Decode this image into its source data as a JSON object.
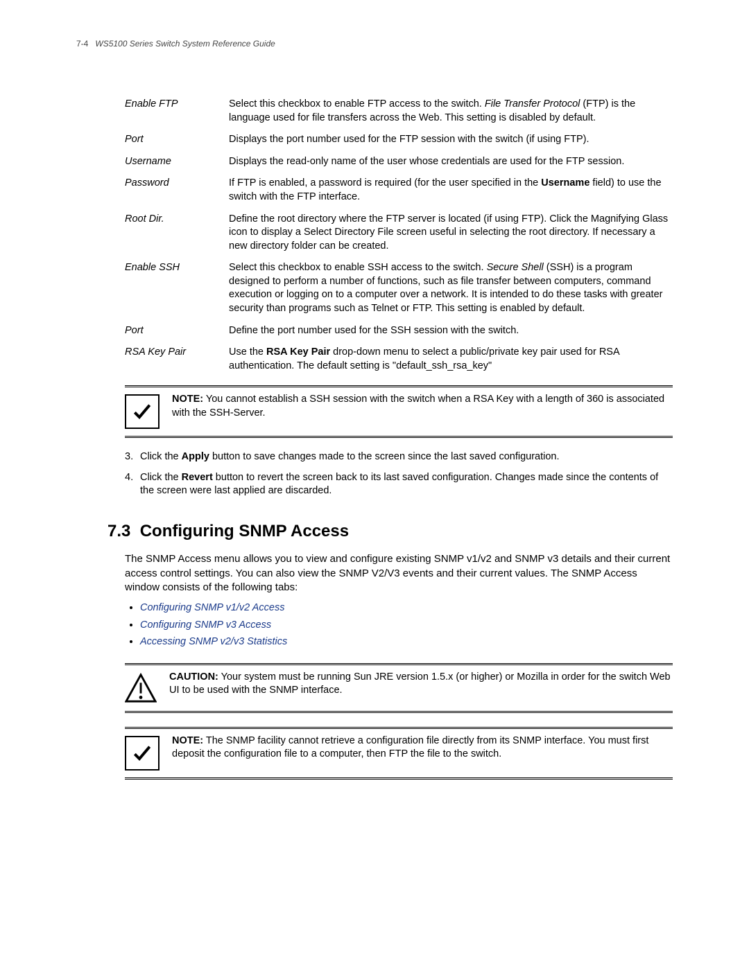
{
  "header": {
    "page_num": "7-4",
    "book_title": "WS5100 Series Switch System Reference Guide"
  },
  "definitions": [
    {
      "term": "Enable FTP",
      "desc": [
        {
          "t": "Select this checkbox to enable FTP access to the switch. "
        },
        {
          "t": "File Transfer Protocol",
          "i": true
        },
        {
          "t": " (FTP) is the language used for file transfers across the Web. This setting is disabled by default."
        }
      ]
    },
    {
      "term": "Port",
      "desc": [
        {
          "t": "Displays the port number used for the FTP session with the switch (if using FTP)."
        }
      ]
    },
    {
      "term": "Username",
      "desc": [
        {
          "t": "Displays the read-only name of the user whose credentials are used for the FTP session."
        }
      ]
    },
    {
      "term": "Password",
      "desc": [
        {
          "t": "If FTP is enabled, a password is required (for the user specified in the "
        },
        {
          "t": "Username",
          "b": true
        },
        {
          "t": " field) to use the switch with the FTP interface."
        }
      ]
    },
    {
      "term": "Root Dir.",
      "desc": [
        {
          "t": "Define the root directory where the FTP server is located (if using FTP). Click the Magnifying Glass icon to display a Select Directory File screen useful in selecting the root directory. If necessary a new directory folder can be created."
        }
      ]
    },
    {
      "term": "Enable SSH",
      "desc": [
        {
          "t": "Select this checkbox to enable SSH access to the switch. "
        },
        {
          "t": "Secure Shell",
          "i": true
        },
        {
          "t": " (SSH) is a program designed to perform a number of functions, such as file transfer between computers, command execution or logging on to a computer over a network. It is intended to do these tasks with greater security than programs such as Telnet or FTP. This setting is enabled by default."
        }
      ]
    },
    {
      "term": "Port",
      "desc": [
        {
          "t": "Define the port number used for the SSH session with the switch."
        }
      ]
    },
    {
      "term": "RSA Key Pair",
      "desc": [
        {
          "t": "Use the "
        },
        {
          "t": "RSA Key Pair",
          "b": true
        },
        {
          "t": " drop-down menu to select a public/private key pair used for RSA authentication. The default setting is \"default_ssh_rsa_key\""
        }
      ]
    }
  ],
  "note1": {
    "label": "NOTE:",
    "text": " You cannot establish a SSH session with the switch when a RSA Key with a length of 360 is associated with the SSH-Server."
  },
  "steps": [
    {
      "parts": [
        {
          "t": "Click the "
        },
        {
          "t": "Apply",
          "b": true
        },
        {
          "t": " button to save changes made to the screen since the last saved configuration."
        }
      ]
    },
    {
      "parts": [
        {
          "t": "Click the "
        },
        {
          "t": "Revert",
          "b": true
        },
        {
          "t": " button to revert the screen back to its last saved configuration. Changes made since the contents of the screen were last applied are discarded."
        }
      ]
    }
  ],
  "section": {
    "number": "7.3",
    "title": "Configuring SNMP Access",
    "intro": "The SNMP Access menu allows you to view and configure existing SNMP v1/v2 and SNMP v3 details and their current access control settings. You can also view the SNMP V2/V3 events and their current values. The SNMP Access window consists of the following tabs:"
  },
  "links": [
    "Configuring SNMP v1/v2 Access",
    "Configuring SNMP v3 Access",
    "Accessing SNMP v2/v3 Statistics"
  ],
  "caution": {
    "label": "CAUTION:",
    "text": " Your system must be running Sun JRE version 1.5.x (or higher) or Mozilla in order for the switch Web UI to be used with the SNMP interface."
  },
  "note2": {
    "label": "NOTE:",
    "text": " The SNMP facility cannot retrieve a configuration file directly from its SNMP interface. You must first deposit the configuration file to a computer, then FTP the file to the switch."
  }
}
